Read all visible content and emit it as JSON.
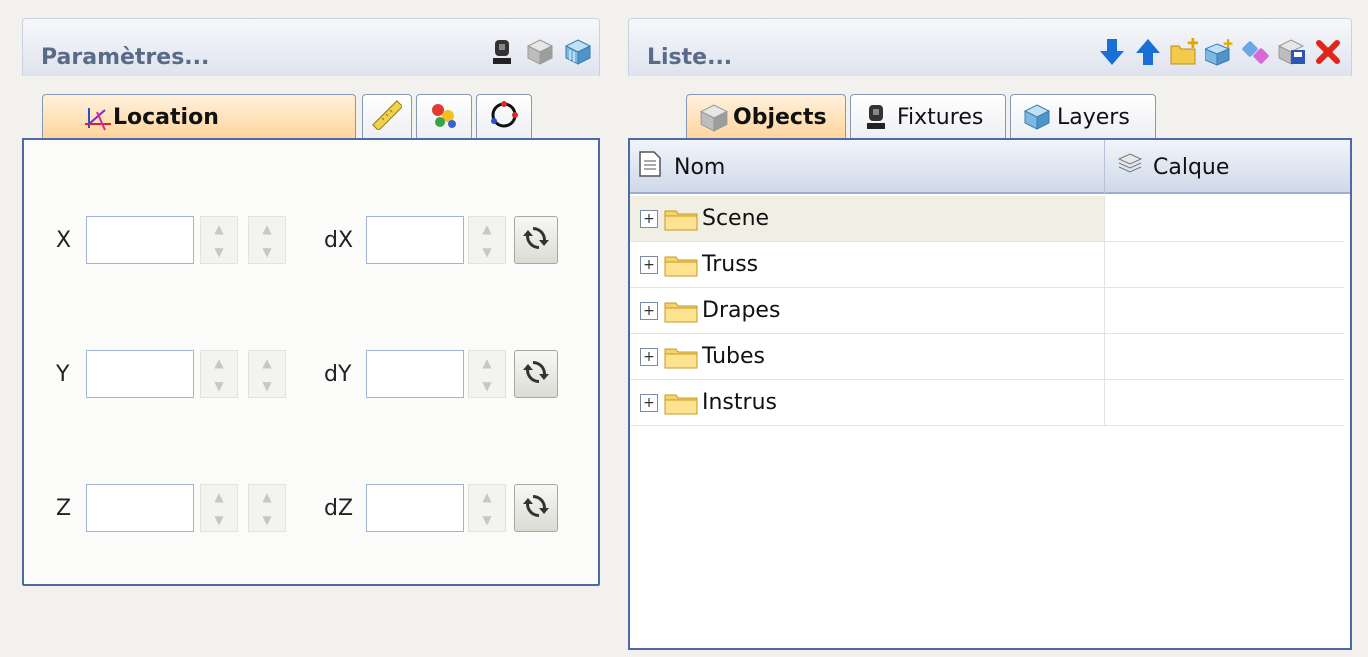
{
  "params_panel": {
    "title": "Paramètres...",
    "toolbar_icons": [
      "fixture-icon",
      "cube-icon",
      "layers-icon"
    ],
    "tabs": [
      {
        "label": "Location",
        "icon": "axes-icon",
        "active": true
      },
      {
        "label": "",
        "icon": "ruler-icon"
      },
      {
        "label": "",
        "icon": "color-icon"
      },
      {
        "label": "",
        "icon": "rotation-icon"
      }
    ],
    "fields": [
      {
        "axis": "X",
        "delta": "dX",
        "value": "",
        "delta_value": ""
      },
      {
        "axis": "Y",
        "delta": "dY",
        "value": "",
        "delta_value": ""
      },
      {
        "axis": "Z",
        "delta": "dZ",
        "value": "",
        "delta_value": ""
      }
    ]
  },
  "list_panel": {
    "title": "Liste...",
    "toolbar_icons": [
      "arrow-down-icon",
      "arrow-up-icon",
      "new-folder-icon",
      "new-layer-icon",
      "link-icon",
      "save-icon",
      "delete-icon"
    ],
    "tabs": [
      {
        "label": "Objects",
        "icon": "cube-icon",
        "active": true
      },
      {
        "label": "Fixtures",
        "icon": "fixture-icon"
      },
      {
        "label": "Layers",
        "icon": "layers-icon"
      }
    ],
    "columns": [
      {
        "label": "Nom",
        "icon": "document-icon"
      },
      {
        "label": "Calque",
        "icon": "stack-icon"
      }
    ],
    "rows": [
      {
        "name": "Scene",
        "layer": "",
        "selected": true
      },
      {
        "name": "Truss",
        "layer": ""
      },
      {
        "name": "Drapes",
        "layer": ""
      },
      {
        "name": "Tubes",
        "layer": ""
      },
      {
        "name": "Instrus",
        "layer": ""
      }
    ]
  },
  "colors": {
    "accent": "#4d6aa6",
    "active_tab": "#ffd49a",
    "title_text": "#5a6b88"
  }
}
